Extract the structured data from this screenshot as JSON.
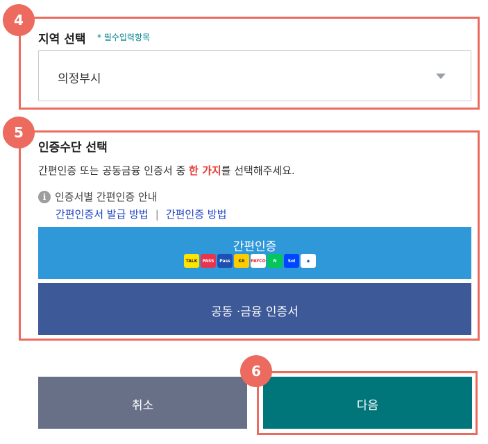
{
  "section4": {
    "step": "4",
    "label": "지역 선택",
    "required_mark": "* 필수입력항목",
    "select_value": "의정부시"
  },
  "section5": {
    "step": "5",
    "label": "인증수단 선택",
    "desc_before": "간편인증 또는 공동금융 인증서 중 ",
    "desc_highlight": "한 가지",
    "desc_after": "를 선택해주세요.",
    "info_text": "인증서별 간편인증 안내",
    "link_issue": "간편인증서 발급 방법",
    "link_separator": "|",
    "link_method": "간편인증 방법",
    "simple_auth_label": "간편인증",
    "cert_label": "공동 ·금융 인증서",
    "providers": [
      {
        "name": "kakao-icon",
        "text": "TALK",
        "bg": "#fee500",
        "fg": "#3a1d1d"
      },
      {
        "name": "pass-icon",
        "text": "PASS",
        "bg": "#e8344e",
        "fg": "#ffffff"
      },
      {
        "name": "samsung-pass-icon",
        "text": "Pass",
        "bg": "#1f4fb3",
        "fg": "#ffffff"
      },
      {
        "name": "kb-icon",
        "text": "KB",
        "bg": "#ffcc00",
        "fg": "#4a3b00"
      },
      {
        "name": "payco-icon",
        "text": "PAYCO",
        "bg": "#ffffff",
        "fg": "#e2252b"
      },
      {
        "name": "naver-icon",
        "text": "N",
        "bg": "#03c75a",
        "fg": "#ffffff"
      },
      {
        "name": "shinhan-icon",
        "text": "Sol",
        "bg": "#0046ff",
        "fg": "#ffffff"
      },
      {
        "name": "toss-icon",
        "text": "◆",
        "bg": "#ffffff",
        "fg": "#1b64da"
      }
    ]
  },
  "footer": {
    "step": "6",
    "cancel_label": "취소",
    "next_label": "다음"
  }
}
